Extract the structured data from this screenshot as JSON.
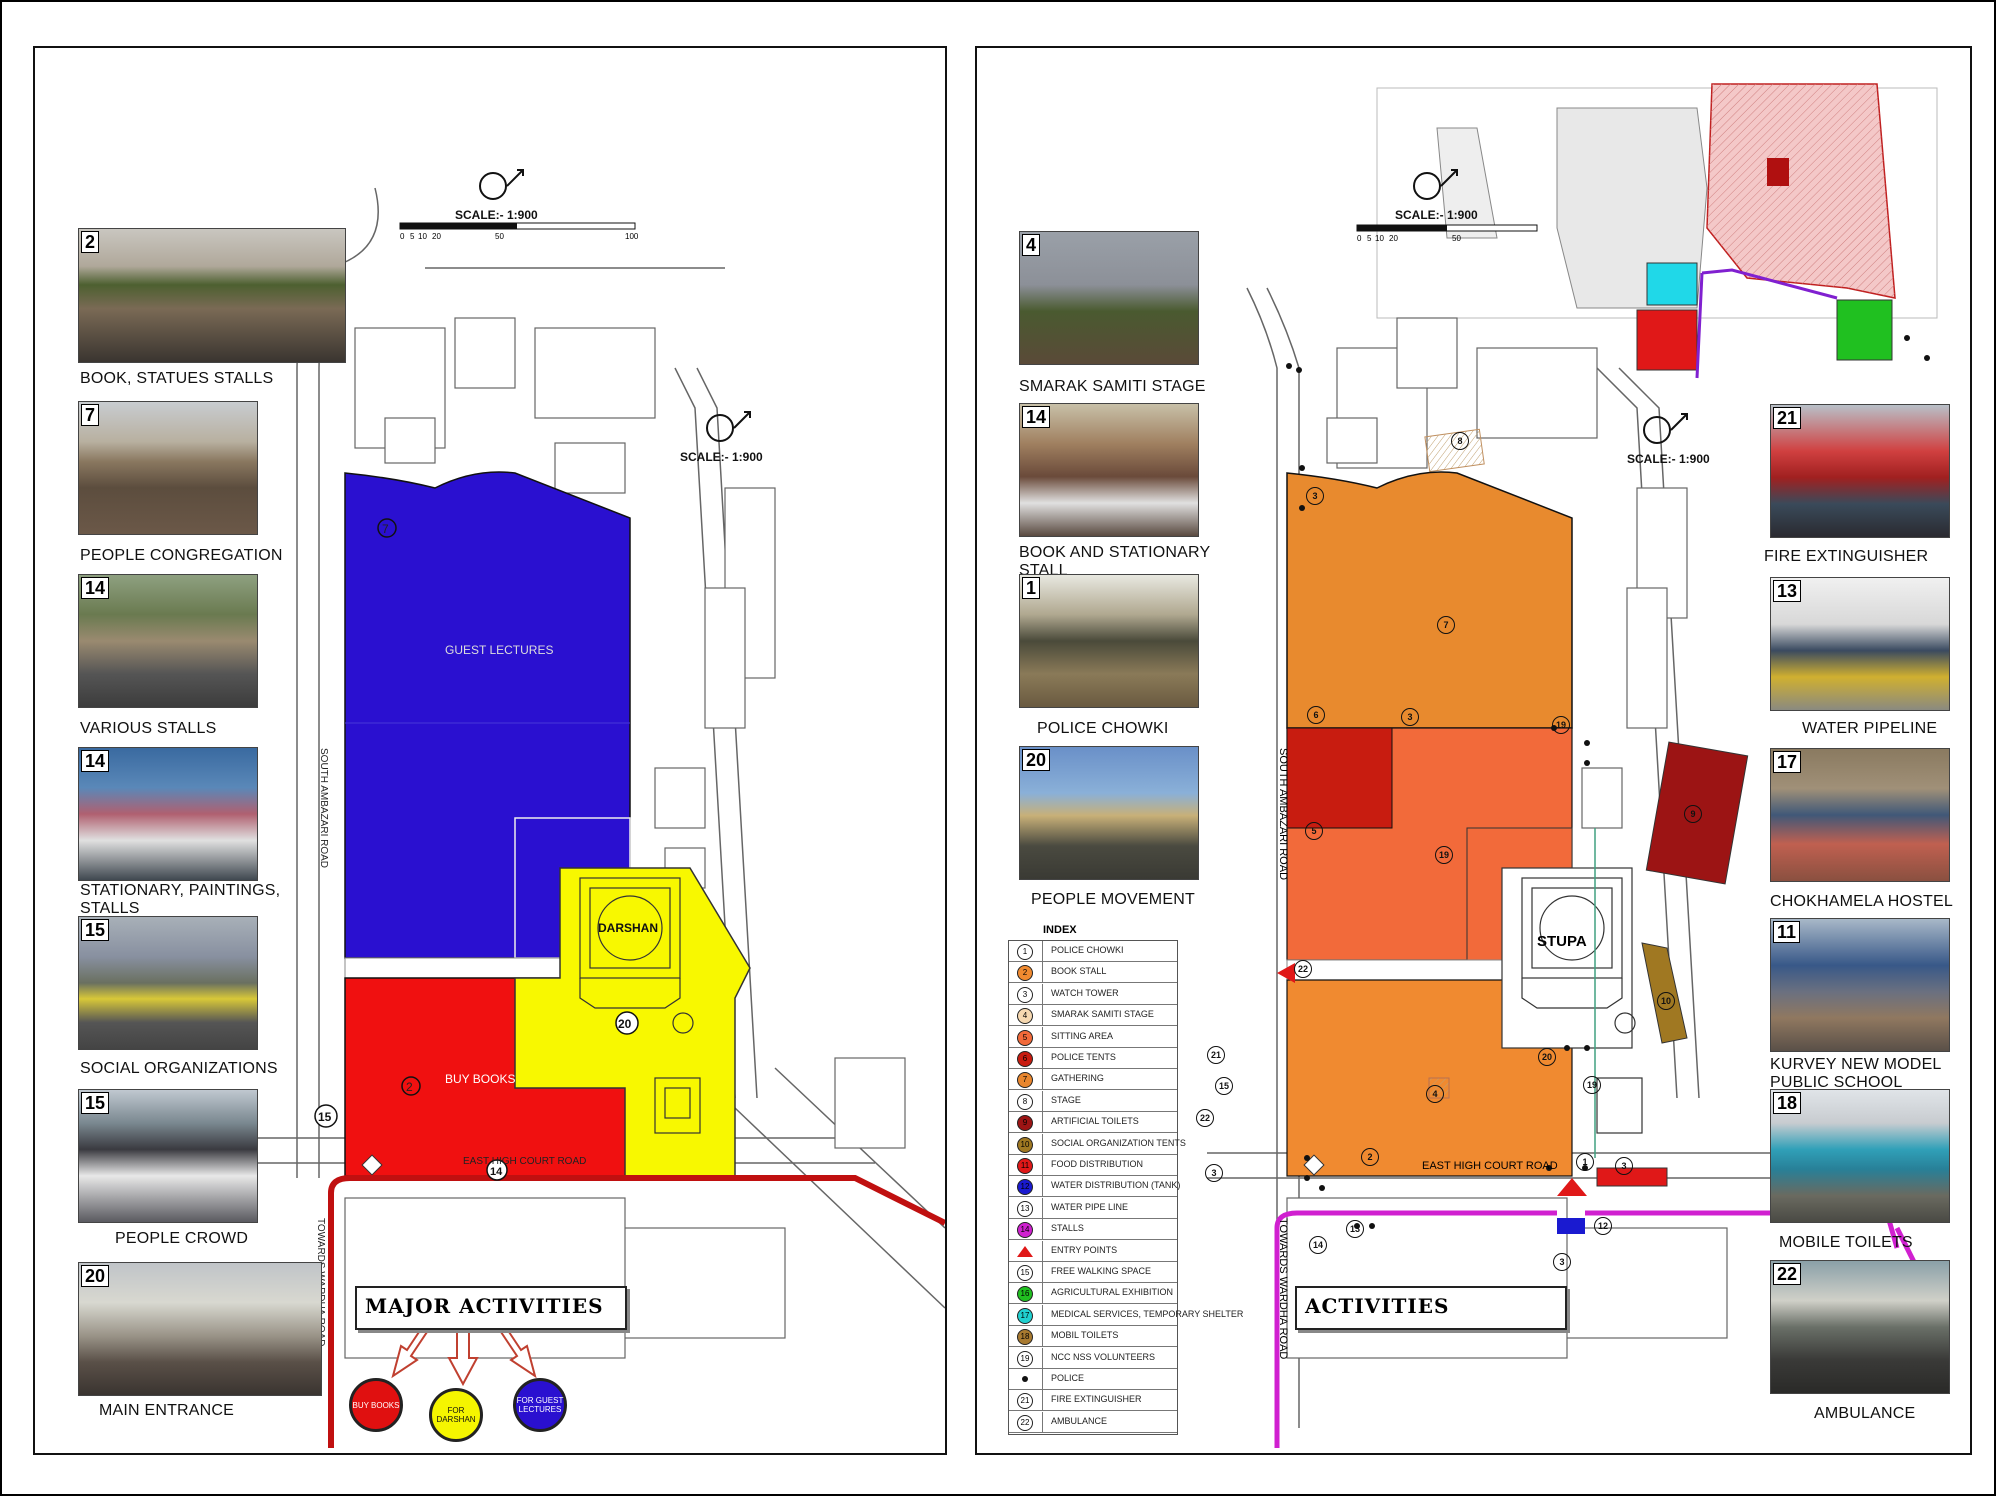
{
  "left_panel": {
    "scale": {
      "label": "SCALE:- 1:900",
      "ticks": [
        "0",
        "5",
        "10",
        "20",
        "50",
        "100"
      ]
    },
    "scale_inner": {
      "label": "SCALE:- 1:900"
    },
    "photos": [
      {
        "num": "2",
        "caption": "BOOK, STATUES STALLS"
      },
      {
        "num": "7",
        "caption": "PEOPLE CONGREGATION"
      },
      {
        "num": "14",
        "caption": "VARIOUS STALLS"
      },
      {
        "num": "14",
        "caption": "STATIONARY, PAINTINGS, STALLS"
      },
      {
        "num": "15",
        "caption": "SOCIAL ORGANIZATIONS"
      },
      {
        "num": "15",
        "caption": "PEOPLE CROWD"
      },
      {
        "num": "20",
        "caption": "MAIN ENTRANCE"
      }
    ],
    "map_labels": {
      "guest_lectures": "GUEST LECTURES",
      "buy_books": "BUY BOOKS",
      "darshan": "DARSHAN",
      "south_road": "SOUTH AMBAZARI ROAD",
      "east_road": "EAST HIGH COURT ROAD",
      "wardha_road": "TOWARDS WARDHA ROAD",
      "num7": "7",
      "num2": "2",
      "num20": "20",
      "num15": "15",
      "num14": "14"
    },
    "title": "MAJOR ACTIVITIES",
    "buttons": [
      {
        "label": "BUY BOOKS",
        "color": "#e01010"
      },
      {
        "label": "FOR DARSHAN",
        "color": "#f5f500"
      },
      {
        "label": "FOR GUEST LECTURES",
        "color": "#2a10d0"
      }
    ]
  },
  "right_panel": {
    "scale": {
      "label": "SCALE:- 1:900",
      "ticks": [
        "0",
        "5",
        "10",
        "20",
        "50"
      ]
    },
    "scale_inner": {
      "label": "SCALE:- 1:900"
    },
    "photos_left": [
      {
        "num": "4",
        "caption": "SMARAK SAMITI STAGE"
      },
      {
        "num": "14",
        "caption": "BOOK AND STATIONARY STALL"
      },
      {
        "num": "1",
        "caption": "POLICE CHOWKI"
      },
      {
        "num": "20",
        "caption": "PEOPLE MOVEMENT"
      }
    ],
    "photos_right": [
      {
        "num": "21",
        "caption": "FIRE EXTINGUISHER"
      },
      {
        "num": "13",
        "caption": "WATER PIPELINE"
      },
      {
        "num": "17",
        "caption": "CHOKHAMELA HOSTEL"
      },
      {
        "num": "11",
        "caption": "KURVEY NEW MODEL PUBLIC SCHOOL"
      },
      {
        "num": "18",
        "caption": "MOBILE TOILETS"
      },
      {
        "num": "22",
        "caption": "AMBULANCE"
      }
    ],
    "map_labels": {
      "stupa": "STUPA",
      "south_road": "SOUTH AMBAZARI ROAD",
      "east_road": "EAST HIGH COURT ROAD",
      "wardha_road": "TOWARDS WARDHA ROAD"
    },
    "index_title": "INDEX",
    "index": [
      {
        "sym": "1",
        "label": "POLICE CHOWKI",
        "color": "#ffffff"
      },
      {
        "sym": "2",
        "label": "BOOK STALL",
        "color": "#f08a30"
      },
      {
        "sym": "3",
        "label": "WATCH TOWER",
        "color": "#ffffff"
      },
      {
        "sym": "4",
        "label": "SMARAK SAMITI STAGE",
        "color": "#f6d8b0"
      },
      {
        "sym": "5",
        "label": "SITTING AREA",
        "color": "#f26a3a"
      },
      {
        "sym": "6",
        "label": "POLICE TENTS",
        "color": "#c81c10"
      },
      {
        "sym": "7",
        "label": "GATHERING",
        "color": "#e8862e"
      },
      {
        "sym": "8",
        "label": "STAGE",
        "color": "#ffffff"
      },
      {
        "sym": "9",
        "label": "ARTIFICIAL TOILETS",
        "color": "#9c1414"
      },
      {
        "sym": "10",
        "label": "SOCIAL ORGANIZATION TENTS",
        "color": "#a07822"
      },
      {
        "sym": "11",
        "label": "FOOD DISTRIBUTION",
        "color": "#e01818"
      },
      {
        "sym": "12",
        "label": "WATER DISTRIBUTION (TANK)",
        "color": "#1a1ad0"
      },
      {
        "sym": "13",
        "label": "WATER PIPE LINE",
        "color": "#ffffff"
      },
      {
        "sym": "14",
        "label": "STALLS",
        "color": "#d020d0"
      },
      {
        "sym": "",
        "label": "ENTRY POINTS",
        "color": "#ffffff"
      },
      {
        "sym": "15",
        "label": "FREE WALKING SPACE",
        "color": "#ffffff"
      },
      {
        "sym": "16",
        "label": "AGRICULTURAL EXHIBITION",
        "color": "#20c020"
      },
      {
        "sym": "17",
        "label": "MEDICAL SERVICES, TEMPORARY SHELTER",
        "color": "#20d0d0"
      },
      {
        "sym": "18",
        "label": "MOBIL TOILETS",
        "color": "#a87a30"
      },
      {
        "sym": "19",
        "label": "NCC NSS VOLUNTEERS",
        "color": "#ffffff"
      },
      {
        "sym": "",
        "label": "POLICE",
        "color": "#ffffff"
      },
      {
        "sym": "21",
        "label": "FIRE EXTINGUISHER",
        "color": "#ffffff"
      },
      {
        "sym": "22",
        "label": "AMBULANCE",
        "color": "#ffffff"
      }
    ],
    "title": "ACTIVITIES",
    "map_nums": [
      "8",
      "3",
      "7",
      "6",
      "3",
      "19",
      "5",
      "19",
      "4",
      "2",
      "20",
      "19",
      "1",
      "3",
      "22",
      "21",
      "15",
      "22",
      "3",
      "9",
      "10",
      "14",
      "13",
      "12",
      "3"
    ]
  }
}
